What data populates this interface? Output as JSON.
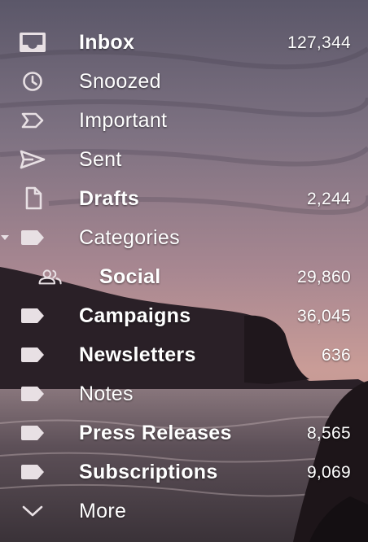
{
  "colors": {
    "text": "#ffffff",
    "icon": "#e8e0e4",
    "sky_top": "#5e5a6d",
    "sky_mid": "#8f7a86",
    "sky_glow": "#c79a95",
    "water": "#5a4e56",
    "land": "#241b21"
  },
  "nav": {
    "items": [
      {
        "key": "inbox",
        "label": "Inbox",
        "count": "127,344",
        "icon": "inbox-icon",
        "bold": true
      },
      {
        "key": "snoozed",
        "label": "Snoozed",
        "count": "",
        "icon": "clock-icon",
        "bold": false
      },
      {
        "key": "important",
        "label": "Important",
        "count": "",
        "icon": "important-marker-icon",
        "bold": false
      },
      {
        "key": "sent",
        "label": "Sent",
        "count": "",
        "icon": "send-icon",
        "bold": false
      },
      {
        "key": "drafts",
        "label": "Drafts",
        "count": "2,244",
        "icon": "draft-document-icon",
        "bold": true
      },
      {
        "key": "categories",
        "label": "Categories",
        "count": "",
        "icon": "label-icon",
        "bold": false,
        "expanded": true
      },
      {
        "key": "social",
        "label": "Social",
        "count": "29,860",
        "icon": "people-icon",
        "bold": true,
        "sub": true
      },
      {
        "key": "campaigns",
        "label": "Campaigns",
        "count": "36,045",
        "icon": "label-icon",
        "bold": true
      },
      {
        "key": "newsletters",
        "label": "Newsletters",
        "count": "636",
        "icon": "label-icon",
        "bold": true
      },
      {
        "key": "notes",
        "label": "Notes",
        "count": "",
        "icon": "label-icon",
        "bold": false
      },
      {
        "key": "press_releases",
        "label": "Press Releases",
        "count": "8,565",
        "icon": "label-icon",
        "bold": true
      },
      {
        "key": "subscriptions",
        "label": "Subscriptions",
        "count": "9,069",
        "icon": "label-icon",
        "bold": true
      },
      {
        "key": "more",
        "label": "More",
        "count": "",
        "icon": "chevron-down-icon",
        "bold": false
      }
    ]
  }
}
